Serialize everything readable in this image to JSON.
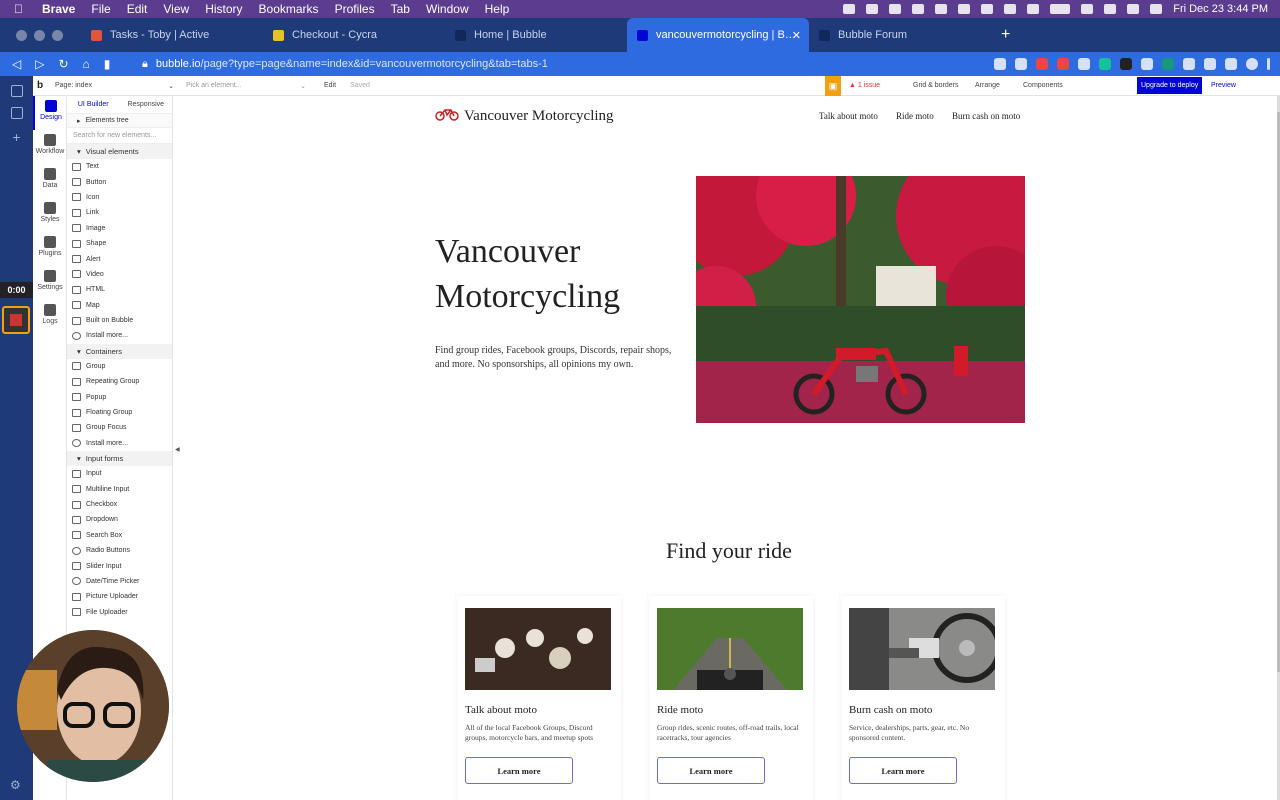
{
  "menubar": {
    "app": "Brave",
    "items": [
      "File",
      "Edit",
      "View",
      "History",
      "Bookmarks",
      "Profiles",
      "Tab",
      "Window",
      "Help"
    ],
    "clock": "Fri Dec 23  3:44 PM"
  },
  "tabs": [
    {
      "label": "Tasks - Toby | Active",
      "color": "#e2553b"
    },
    {
      "label": "Checkout - Cycra",
      "color": "#e6c323"
    },
    {
      "label": "Home | Bubble",
      "color": "#1e3a78"
    },
    {
      "label": "vancouvermotorcycling | Bubble",
      "color": "#0205d3"
    },
    {
      "label": "Bubble Forum",
      "color": "#1e3a78"
    }
  ],
  "address": {
    "host": "bubble.io",
    "path": "/page?type=page&name=index&id=vancouvermotorcycling&tab=tabs-1"
  },
  "bubble_toolbar": {
    "page_label": "Page: index",
    "pick_placeholder": "Pick an element...",
    "edit": "Edit",
    "saved": "Saved",
    "issue": "1 issue",
    "grid": "Grid & borders",
    "arrange": "Arrange",
    "components": "Components",
    "upgrade": "Upgrade to deploy",
    "preview": "Preview"
  },
  "timer": "0:00",
  "sidenav": [
    "Design",
    "Workflow",
    "Data",
    "Styles",
    "Plugins",
    "Settings",
    "Logs"
  ],
  "panel": {
    "tabs": [
      "UI Builder",
      "Responsive"
    ],
    "elements_tree": "Elements tree",
    "search_placeholder": "Search for new elements...",
    "sections": [
      {
        "title": "Visual elements",
        "items": [
          "Text",
          "Button",
          "Icon",
          "Link",
          "Image",
          "Shape",
          "Alert",
          "Video",
          "HTML",
          "Map",
          "Built on Bubble",
          "Install more..."
        ]
      },
      {
        "title": "Containers",
        "items": [
          "Group",
          "Repeating Group",
          "Popup",
          "Floating Group",
          "Group Focus",
          "Install more..."
        ]
      },
      {
        "title": "Input forms",
        "items": [
          "Input",
          "Multiline Input",
          "Checkbox",
          "Dropdown",
          "Search Box",
          "Radio Buttons",
          "Slider Input",
          "Date/Time Picker",
          "Picture Uploader",
          "File Uploader"
        ]
      }
    ]
  },
  "site": {
    "logo_text": "Vancouver Motorcycling",
    "nav": [
      "Talk about moto",
      "Ride moto",
      "Burn cash on moto"
    ],
    "hero_title": "Vancouver Motorcycling",
    "hero_sub": "Find group rides, Facebook groups, Discords, repair shops, and more. No sponsorships, all opinions my own.",
    "section_title": "Find your ride",
    "cards": [
      {
        "title": "Talk about moto",
        "desc": "All of the local Facebook Groups, Discord groups, motorcycle bars, and meetup spots",
        "button": "Learn more"
      },
      {
        "title": "Ride moto",
        "desc": "Group rides, scenic routes, off-road trails, local racetracks, tour agencies",
        "button": "Learn more"
      },
      {
        "title": "Burn cash on moto",
        "desc": "Service, dealerships, parts, gear, etc. No sponsored content.",
        "button": "Learn more"
      }
    ]
  }
}
